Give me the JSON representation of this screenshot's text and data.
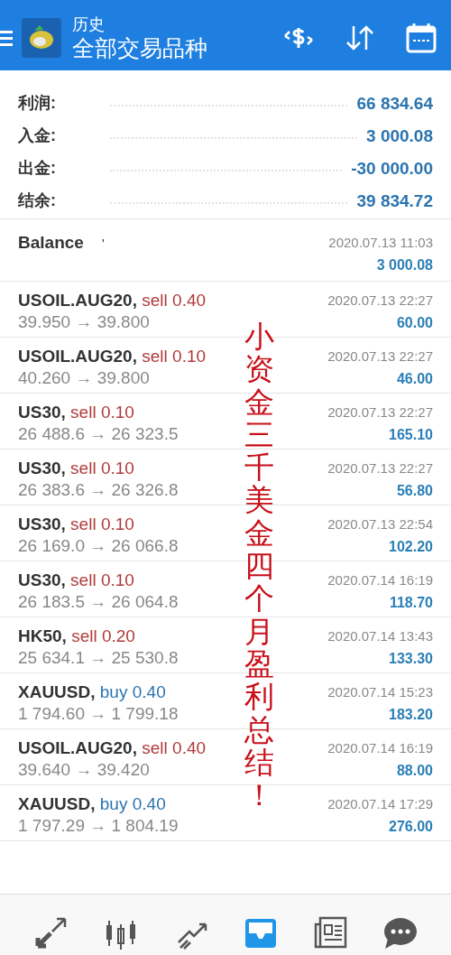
{
  "header": {
    "title": "历史",
    "subtitle": "全部交易品种"
  },
  "summary": [
    {
      "label": "利润:",
      "value": "66 834.64"
    },
    {
      "label": "入金:",
      "value": "3 000.08"
    },
    {
      "label": "出金:",
      "value": "-30 000.00"
    },
    {
      "label": "结余:",
      "value": "39 834.72"
    }
  ],
  "deals": [
    {
      "kind": "balance",
      "symbol": "Balance",
      "note": "'",
      "time": "2020.07.13 11:03",
      "amount": "3 000.08"
    },
    {
      "kind": "trade",
      "symbol": "USOIL.AUG20,",
      "side": "sell",
      "volume": "0.40",
      "prices": "39.950 → 39.800",
      "time": "2020.07.13 22:27",
      "amount": "60.00"
    },
    {
      "kind": "trade",
      "symbol": "USOIL.AUG20,",
      "side": "sell",
      "volume": "0.10",
      "prices": "40.260 → 39.800",
      "time": "2020.07.13 22:27",
      "amount": "46.00"
    },
    {
      "kind": "trade",
      "symbol": "US30,",
      "side": "sell",
      "volume": "0.10",
      "prices": "26 488.6 → 26 323.5",
      "time": "2020.07.13 22:27",
      "amount": "165.10"
    },
    {
      "kind": "trade",
      "symbol": "US30,",
      "side": "sell",
      "volume": "0.10",
      "prices": "26 383.6 → 26 326.8",
      "time": "2020.07.13 22:27",
      "amount": "56.80"
    },
    {
      "kind": "trade",
      "symbol": "US30,",
      "side": "sell",
      "volume": "0.10",
      "prices": "26 169.0 → 26 066.8",
      "time": "2020.07.13 22:54",
      "amount": "102.20"
    },
    {
      "kind": "trade",
      "symbol": "US30,",
      "side": "sell",
      "volume": "0.10",
      "prices": "26 183.5 → 26 064.8",
      "time": "2020.07.14 16:19",
      "amount": "118.70"
    },
    {
      "kind": "trade",
      "symbol": "HK50,",
      "side": "sell",
      "volume": "0.20",
      "prices": "25 634.1 → 25 530.8",
      "time": "2020.07.14 13:43",
      "amount": "133.30"
    },
    {
      "kind": "trade",
      "symbol": "XAUUSD,",
      "side": "buy",
      "volume": "0.40",
      "prices": "1 794.60 → 1 799.18",
      "time": "2020.07.14 15:23",
      "amount": "183.20"
    },
    {
      "kind": "trade",
      "symbol": "USOIL.AUG20,",
      "side": "sell",
      "volume": "0.40",
      "prices": "39.640 → 39.420",
      "time": "2020.07.14 16:19",
      "amount": "88.00"
    },
    {
      "kind": "trade",
      "symbol": "XAUUSD,",
      "side": "buy",
      "volume": "0.40",
      "prices": "1 797.29 → 1 804.19",
      "time": "2020.07.14 17:29",
      "amount": "276.00"
    }
  ],
  "annotation": "小资金三千美金四个月盈利总结！",
  "nav": [
    {
      "selected": false
    },
    {
      "selected": false
    },
    {
      "selected": false
    },
    {
      "selected": true
    },
    {
      "selected": false
    },
    {
      "selected": false
    }
  ]
}
